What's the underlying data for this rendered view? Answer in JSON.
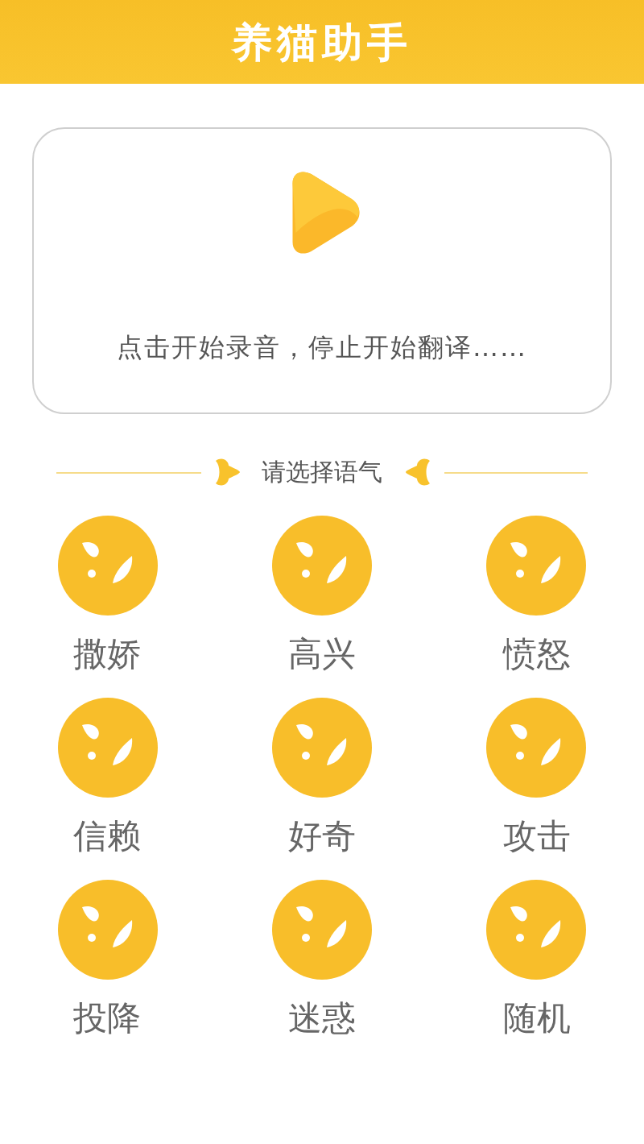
{
  "header": {
    "title": "养猫助手"
  },
  "record_card": {
    "hint": "点击开始录音，停止开始翻译……"
  },
  "tone_section": {
    "title": "请选择语气"
  },
  "tones": [
    {
      "label": "撒娇"
    },
    {
      "label": "高兴"
    },
    {
      "label": "愤怒"
    },
    {
      "label": "信赖"
    },
    {
      "label": "好奇"
    },
    {
      "label": "攻击"
    },
    {
      "label": "投降"
    },
    {
      "label": "迷惑"
    },
    {
      "label": "随机"
    }
  ]
}
